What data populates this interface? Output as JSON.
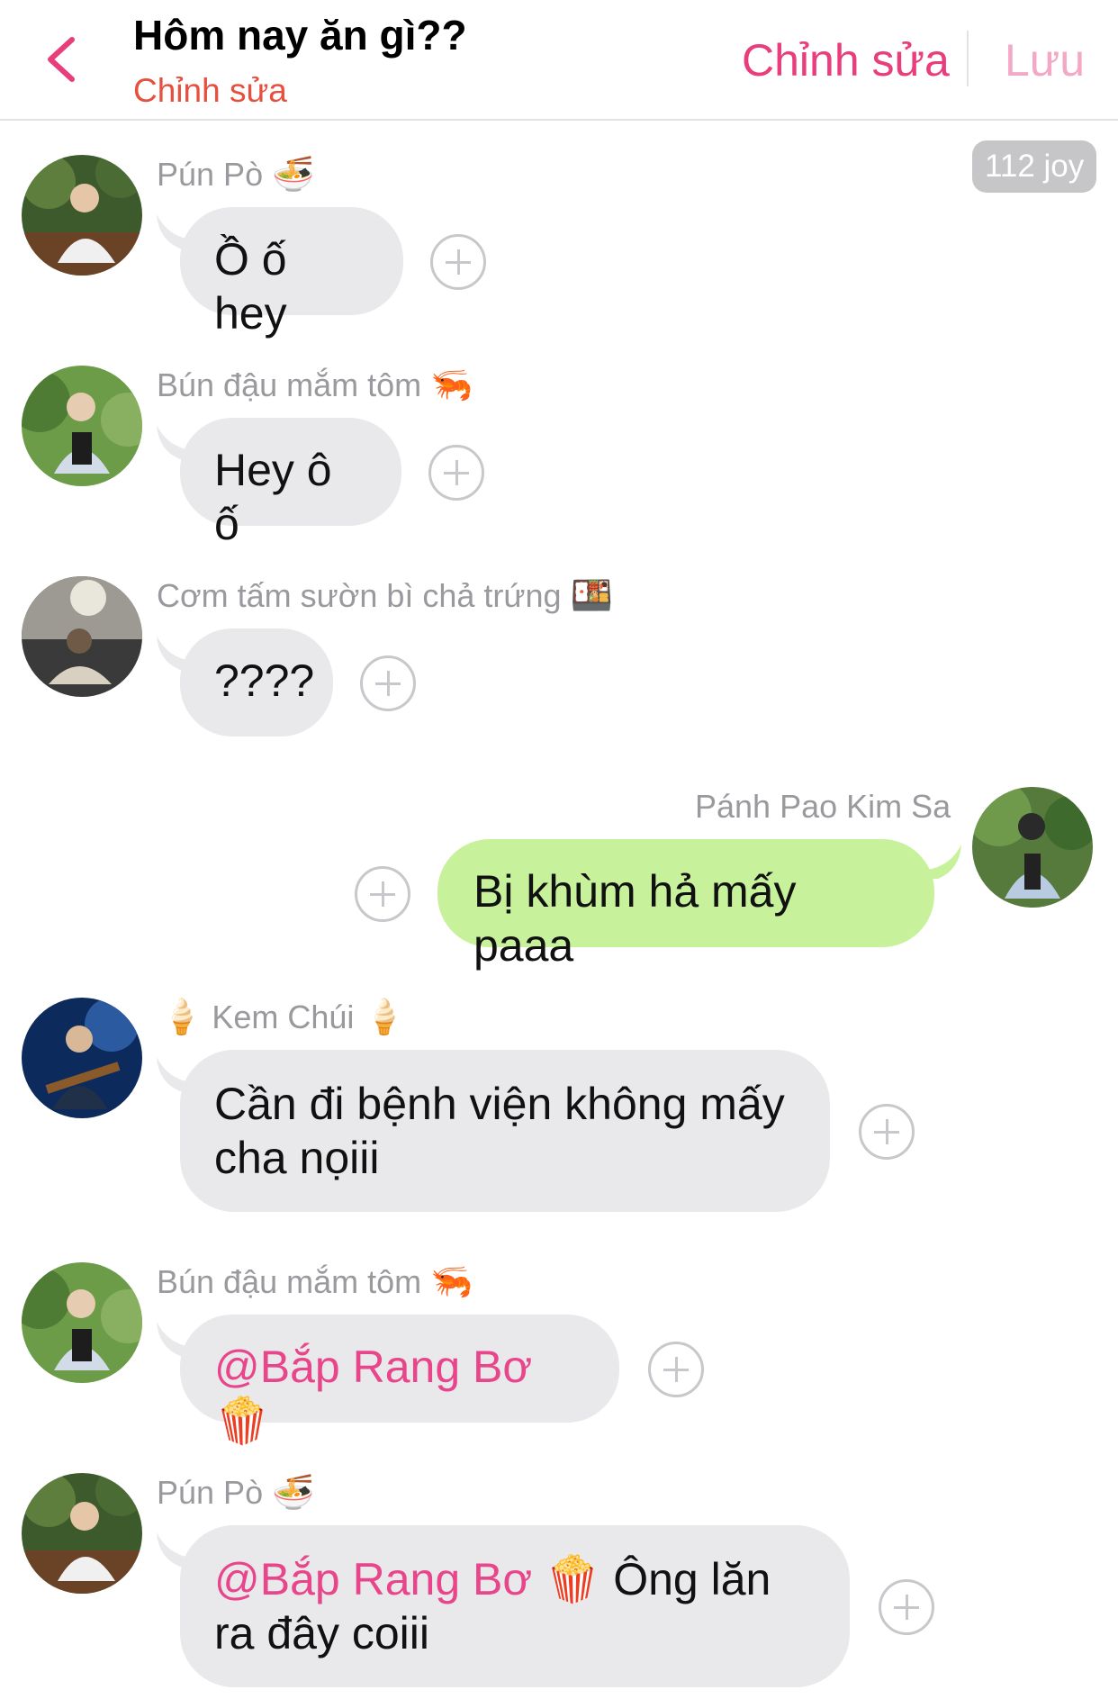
{
  "header": {
    "title": "Hôm nay ăn gì??",
    "subtitle": "Chỉnh sửa",
    "edit_label": "Chỉnh sửa",
    "save_label": "Lưu"
  },
  "joy_badge": "112 joy",
  "messages": [
    {
      "sender": "Pún Pò",
      "emoji": "🍜",
      "text": "Ồ ố hey"
    },
    {
      "sender": "Bún đậu mắm tôm",
      "emoji": "🦐",
      "text": "Hey ô ố"
    },
    {
      "sender": "Cơm tấm sườn bì chả trứng",
      "emoji": "🍱",
      "text": "????"
    },
    {
      "sender": "Pánh Pao Kim Sa",
      "text": "Bị khùm hả mấy paaa"
    },
    {
      "sender": "Kem Chúi",
      "emoji_before": "🍦",
      "emoji": "🍦",
      "text": "Cần đi bệnh viện không mấy cha nọiii"
    },
    {
      "sender": "Bún đậu mắm tôm",
      "emoji": "🦐",
      "mention": "@Bắp Rang Bơ 🍿"
    },
    {
      "sender": "Pún Pò",
      "emoji": "🍜",
      "mention": "@Bắp Rang Bơ 🍿",
      "text": " Ông lăn ra đây coiii"
    }
  ],
  "colors": {
    "accent": "#e83e7c",
    "accent_light": "#f3a9c6",
    "subtitle": "#e5503f",
    "bubble_other": "#e9e9eb",
    "bubble_me": "#c7f19a"
  }
}
